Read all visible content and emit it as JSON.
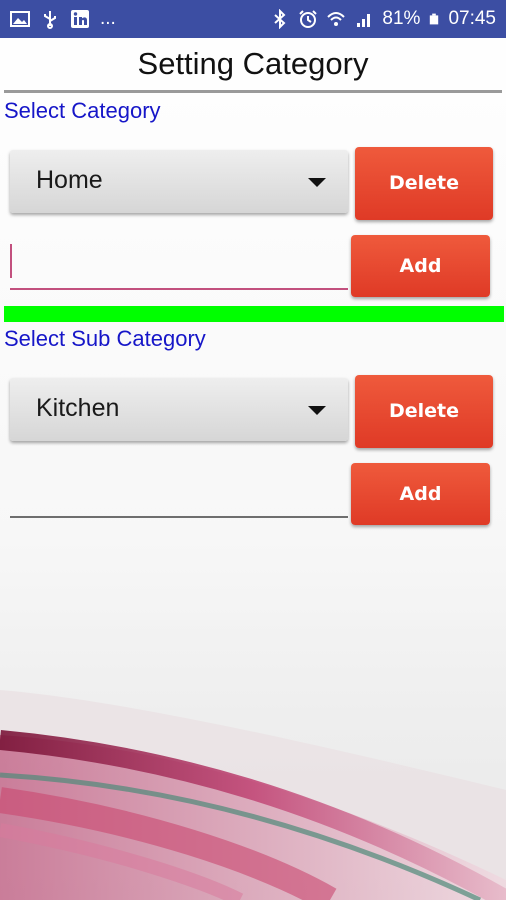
{
  "status_bar": {
    "left_icons": [
      "image-icon",
      "usb-icon",
      "linkedin-icon"
    ],
    "more": "...",
    "right_icons": [
      "bluetooth-icon",
      "alarm-icon",
      "wifi-icon",
      "signal-icon",
      "battery-icon"
    ],
    "battery": "81%",
    "time": "07:45"
  },
  "page": {
    "title": "Setting Category"
  },
  "category": {
    "label": "Select Category",
    "selected": "Home",
    "delete_label": "Delete",
    "add_label": "Add",
    "input_value": ""
  },
  "sub_category": {
    "label": "Select Sub Category",
    "selected": "Kitchen",
    "delete_label": "Delete",
    "add_label": "Add",
    "input_value": ""
  },
  "colors": {
    "status_bar": "#3c4ea3",
    "label_blue": "#1616c8",
    "button_red": "#e5452d",
    "divider_green": "#00ff00",
    "focus_underline": "#c2507e"
  }
}
